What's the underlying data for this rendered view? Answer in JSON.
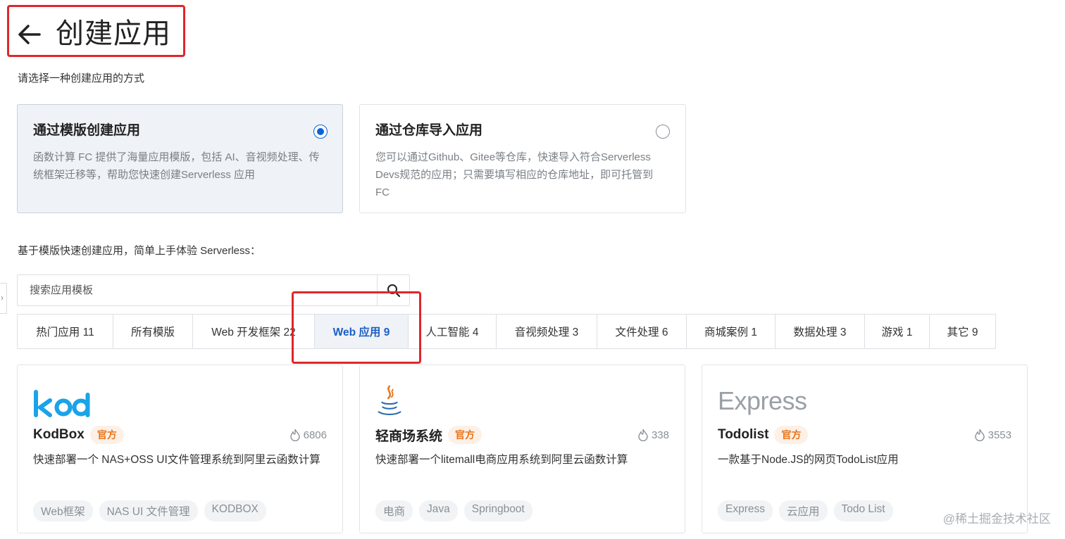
{
  "header": {
    "title": "创建应用",
    "subtitle": "请选择一种创建应用的方式"
  },
  "methods": [
    {
      "title": "通过模版创建应用",
      "desc": "函数计算 FC 提供了海量应用模版，包括 AI、音视频处理、传统框架迁移等，帮助您快速创建Serverless 应用",
      "selected": true
    },
    {
      "title": "通过仓库导入应用",
      "desc": "您可以通过Github、Gitee等仓库，快速导入符合Serverless Devs规范的应用；只需要填写相应的仓库地址，即可托管到 FC",
      "selected": false
    }
  ],
  "section_label": "基于模版快速创建应用，简单上手体验 Serverless：",
  "search": {
    "placeholder": "搜索应用模板",
    "icon": "search-icon"
  },
  "tabs": [
    {
      "label": "热门应用 11"
    },
    {
      "label": "所有模版"
    },
    {
      "label": "Web 开发框架 22"
    },
    {
      "label": "Web 应用 9",
      "active": true
    },
    {
      "label": "人工智能 4"
    },
    {
      "label": "音视频处理 3"
    },
    {
      "label": "文件处理 6"
    },
    {
      "label": "商城案例 1"
    },
    {
      "label": "数据处理 3"
    },
    {
      "label": "游戏 1"
    },
    {
      "label": "其它 9"
    }
  ],
  "templates": [
    {
      "logo": "kod",
      "name": "KodBox",
      "badge": "官方",
      "hot": "6806",
      "desc": "快速部署一个 NAS+OSS UI文件管理系统到阿里云函数计算",
      "tags": [
        "Web框架",
        "NAS UI 文件管理",
        "KODBOX"
      ]
    },
    {
      "logo": "java-icon",
      "name": "轻商场系统",
      "badge": "官方",
      "hot": "338",
      "desc": "快速部署一个litemall电商应用系统到阿里云函数计算",
      "tags": [
        "电商",
        "Java",
        "Springboot"
      ]
    },
    {
      "logo": "Express",
      "name": "Todolist",
      "badge": "官方",
      "hot": "3553",
      "desc": "一款基于Node.JS的网页TodoList应用",
      "tags": [
        "Express",
        "云应用",
        "Todo List"
      ]
    }
  ],
  "watermark": "@稀土掘金技术社区",
  "colors": {
    "accent": "#0a64d6",
    "annotation": "#e0262b",
    "badge_text": "#e8741a",
    "badge_bg": "#fdf0e6",
    "kod_blue": "#1aa3e8"
  }
}
